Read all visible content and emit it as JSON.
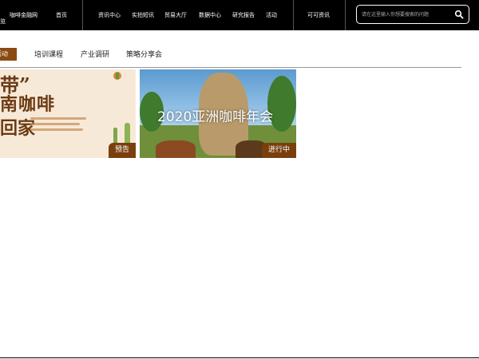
{
  "nav": {
    "brand_cut": "览",
    "brand": "咖啡金融网",
    "home": "首页",
    "items": [
      "资讯中心",
      "实拍短讯",
      "贸易大厅",
      "数据中心",
      "研究报告",
      "活动"
    ],
    "extra": "可可资讯"
  },
  "search": {
    "placeholder": "请在这里输入你想要搜索的问题",
    "icon": "search-icon"
  },
  "tabs": {
    "active": "活动",
    "items": [
      "培训课程",
      "产业调研",
      "策略分享会"
    ]
  },
  "cards": [
    {
      "poster_text": {
        "quote": "带”",
        "line1": "南咖啡",
        "line2": "回家"
      },
      "badge": "预告"
    },
    {
      "title": "2020亚洲咖啡年会",
      "badge": "进行中"
    }
  ],
  "colors": {
    "nav_bg": "#000000",
    "accent": "#7a3f0d",
    "tab_active": "#8a4a10"
  }
}
